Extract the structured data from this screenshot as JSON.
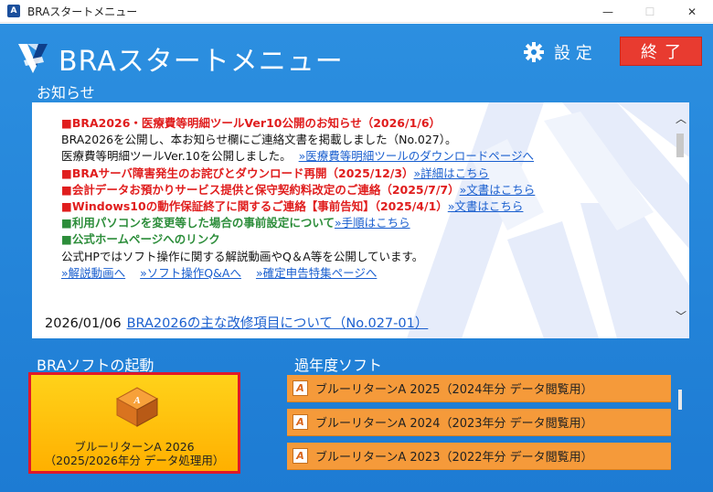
{
  "window": {
    "title": "BRAスタートメニュー",
    "icon_letter": "A",
    "minimize": "—",
    "maximize": "☐",
    "close": "✕"
  },
  "header": {
    "app_title": "BRAスタートメニュー",
    "settings_label": "設 定",
    "exit_label": "終了"
  },
  "news": {
    "section_label": "お知らせ",
    "items": [
      {
        "bullet": "■",
        "text": "BRA2026・医療費等明細ツールVer10公開のお知らせ（2026/1/6）"
      },
      {
        "text": "BRA2026を公開し、本お知らせ欄にご連絡文書を掲載しました（No.027）。"
      },
      {
        "text": "医療費等明細ツールVer.10を公開しました。",
        "link": "»医療費等明細ツールのダウンロードページへ"
      },
      {
        "bullet": "■",
        "text": "BRAサーバ障害発生のお詫びとダウンロード再開（2025/12/3）",
        "link": "»詳細はこちら"
      },
      {
        "bullet": "■",
        "text": "会計データお預かりサービス提供と保守契約料改定のご連絡（2025/7/7）",
        "link": "»文書はこちら"
      },
      {
        "bullet": "■",
        "text": "Windows10の動作保証終了に関するご連絡【事前告知】（2025/4/1）",
        "link": "»文書はこちら"
      },
      {
        "bullet": "■",
        "text": "利用パソコンを変更等した場合の事前設定について",
        "link": "»手順はこちら"
      },
      {
        "bullet": "■",
        "text": "公式ホームページへのリンク"
      },
      {
        "text": "公式HPではソフト操作に関する解説動画やQ＆A等を公開しています。"
      },
      {
        "links": [
          "»解説動画へ",
          "»ソフト操作Q&Aへ",
          "»確定申告特集ページへ"
        ]
      }
    ],
    "footer_date": "2026/01/06",
    "footer_link": "BRA2026の主な改修項目について（No.027-01）",
    "scroll_up": "︿",
    "scroll_down": "﹀"
  },
  "launch": {
    "section_label": "BRAソフトの起動",
    "icon_letter": "A",
    "line1": "ブルーリターンA 2026",
    "line2": "（2025/2026年分 データ処理用）"
  },
  "past": {
    "section_label": "過年度ソフト",
    "icon_letter": "A",
    "items": [
      "ブルーリターンA 2025（2024年分 データ閲覧用）",
      "ブルーリターンA 2024（2023年分 データ閲覧用）",
      "ブルーリターンA 2023（2022年分 データ閲覧用）"
    ]
  },
  "colors": {
    "accent_blue": "#1d7bd3",
    "exit_red": "#e83b30",
    "launch_yellow": "#ffc107",
    "past_orange": "#f59a3a",
    "news_red": "#e01d1d",
    "news_green": "#2c8d3a",
    "link_blue": "#1a5fcf"
  }
}
